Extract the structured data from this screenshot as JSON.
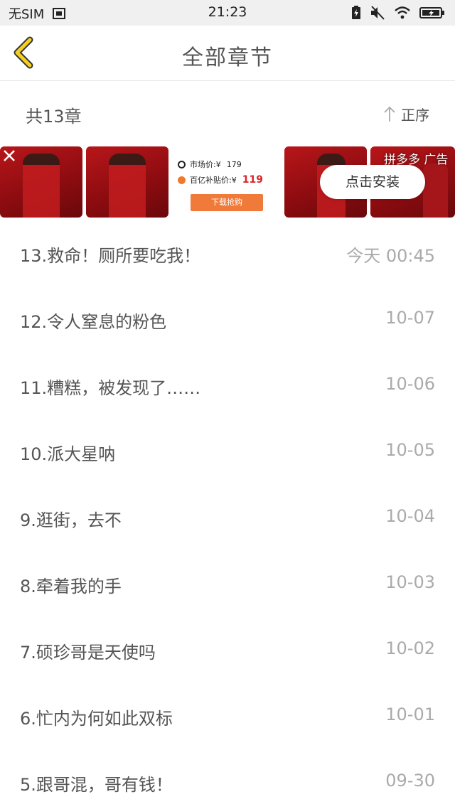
{
  "status_bar": {
    "carrier": "无SIM",
    "time": "21:23",
    "icons": [
      "sim-card-icon",
      "battery-charge-icon",
      "mute-icon",
      "wifi-icon",
      "battery-icon"
    ]
  },
  "header": {
    "back_icon": "chevron-left-icon",
    "title": "全部章节"
  },
  "summary": {
    "count_text": "共13章",
    "sort_label": "正序",
    "sort_icon": "arrow-up-icon"
  },
  "ad": {
    "market_label": "市场价:¥",
    "market_price": "179",
    "subsidy_label": "百亿补贴价:¥",
    "subsidy_price": "119",
    "buy_label": "下载抢购",
    "ad_label": "拼多多 广告",
    "install_label": "点击安装",
    "close_icon": "close-icon",
    "colors": {
      "ad_red": "#b8161a",
      "button_orange": "#f07a3a",
      "price_red": "#d8262b"
    }
  },
  "chapters": [
    {
      "title": "13.救命！厕所要吃我！",
      "date": "今天 00:45"
    },
    {
      "title": "12.令人窒息的粉色",
      "date": "10-07"
    },
    {
      "title": "11.糟糕，被发现了……",
      "date": "10-06"
    },
    {
      "title": "10.派大星呐",
      "date": "10-05"
    },
    {
      "title": "9.逛街，去不",
      "date": "10-04"
    },
    {
      "title": "8.牵着我的手",
      "date": "10-03"
    },
    {
      "title": "7.硕珍哥是天使吗",
      "date": "10-02"
    },
    {
      "title": "6.忙内为何如此双标",
      "date": "10-01"
    },
    {
      "title": "5.跟哥混，哥有钱！",
      "date": "09-30"
    }
  ],
  "colors": {
    "accent_yellow": "#f5d020",
    "text": "#555555",
    "date_text": "#aaaaaa"
  }
}
